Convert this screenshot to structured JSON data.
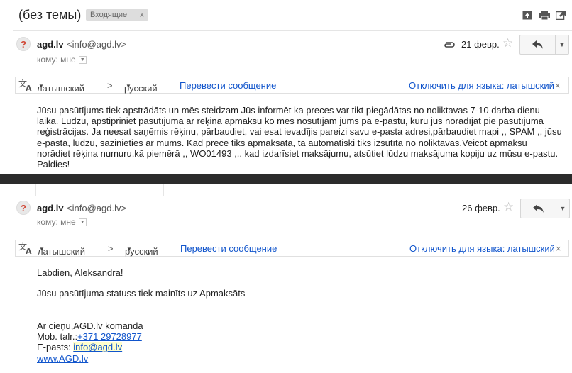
{
  "subject": "(без темы)",
  "label": {
    "text": "Входящие",
    "remove": "x"
  },
  "toolbar_icons": [
    "archive-icon",
    "print-icon",
    "new-window-icon"
  ],
  "messages": [
    {
      "avatar": "?",
      "sender_name": "agd.lv",
      "sender_email": "<info@agd.lv>",
      "to_label": "кому: мне",
      "date": "21 февр.",
      "has_attachment": true,
      "translate": {
        "source": "латышский",
        "arrow": ">",
        "target": "русский",
        "translate_link": "Перевести сообщение",
        "disable_link": "Отключить для языка: латышский",
        "close": "×"
      },
      "body": "Jūsu pasūtījums tiek apstrādāts un mēs steidzam Jūs informēt ka preces var tikt piegādātas no noliktavas 7-10 darba dienu laikā. Lūdzu, apstipriniet pasūtījuma ar rēķina apmaksu ko mēs nosūtījām jums pa e-pastu, kuru jūs norādījāt pie pasūtījuma reģistrācijas. Ja neesat saņēmis rēķinu, pārbaudiet, vai esat ievadījis pareizi savu e-pasta adresi,pārbaudiet mapi ,, SPAM ,, jūsu e-pastā, lūdzu, sazinieties ar mums. Kad prece tiks apmaksāta, tā automātiski tiks izsūtīta no noliktavas.Veicot apmaksu norādiet rēķina numuru,kā piemērā ,, WO01493 ,,. kad izdarīsiet maksājumu, atsūtiet lūdzu maksājuma kopiju uz mūsu e-pastu. Paldies!"
    },
    {
      "avatar": "?",
      "sender_name": "agd.lv",
      "sender_email": "<info@agd.lv>",
      "to_label": "кому: мне",
      "date": "26 февр.",
      "translate": {
        "source": "латышский",
        "arrow": ">",
        "target": "русский",
        "translate_link": "Перевести сообщение",
        "disable_link": "Отключить для языка: латышский",
        "close": "×"
      },
      "greeting": "Labdien, Aleksandra!",
      "status_line": "Jūsu pasūtījuma statuss tiek mainīts uz Apmaksāts",
      "signature": {
        "line1": "Ar cieņu,AGD.lv komanda",
        "phone_label": "Mob. talr.:",
        "phone": "+371 29728977",
        "email_label": "E-pasts: ",
        "email": "info@agd.lv",
        "website": "www.AGD.lv"
      }
    }
  ],
  "colors": {
    "link": "#1155cc",
    "separator": "#2b2b2b",
    "label_bg": "#dddddd"
  }
}
